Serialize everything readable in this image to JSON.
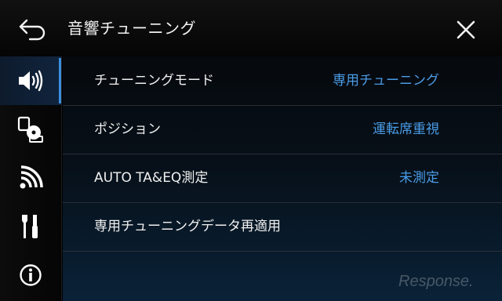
{
  "header": {
    "title": "音響チューニング",
    "back_icon": "back-arrow-icon",
    "close_icon": "close-icon"
  },
  "sidebar": {
    "items": [
      {
        "icon": "speaker-icon",
        "active": true
      },
      {
        "icon": "devices-icon",
        "active": false
      },
      {
        "icon": "wireless-signal-icon",
        "active": false
      },
      {
        "icon": "tools-icon",
        "active": false
      },
      {
        "icon": "info-icon",
        "active": false
      }
    ]
  },
  "menu": {
    "rows": [
      {
        "label": "チューニングモード",
        "value": "専用チューニング"
      },
      {
        "label": "ポジション",
        "value": "運転席重視"
      },
      {
        "label": "AUTO TA&EQ測定",
        "value": "未測定"
      },
      {
        "label": "専用チューニングデータ再適用",
        "value": ""
      }
    ]
  },
  "watermark": "Response.",
  "colors": {
    "accent": "#4a9be6",
    "active_bar": "#3b8fe0",
    "background": "#000000"
  }
}
